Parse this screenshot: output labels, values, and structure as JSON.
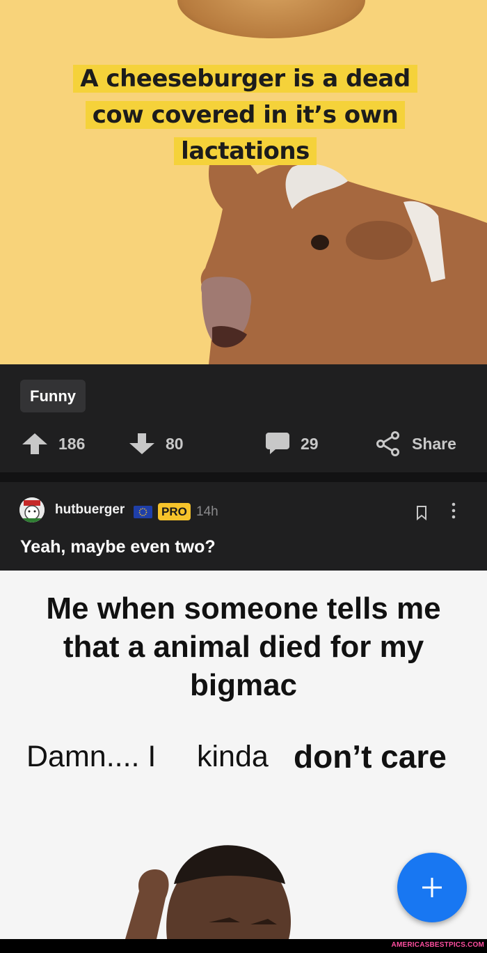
{
  "post": {
    "image_caption": "A cheeseburger is a dead cow covered in it’s own lactations",
    "tag": "Funny",
    "upvotes": "186",
    "downvotes": "80",
    "comments": "29",
    "share_label": "Share"
  },
  "comment": {
    "username": "hutbuerger",
    "badge": "PRO",
    "time": "14h",
    "text": "Yeah, maybe even two?",
    "image": {
      "title": "Me when someone tells me that a animal died for my bigmac",
      "word1": "Damn.... I",
      "word2": "kinda",
      "word3": "don’t care"
    }
  },
  "fab": {
    "icon": "plus-icon"
  },
  "watermark": "AMERICASBESTPICS.COM",
  "colors": {
    "accent": "#1877f2",
    "pro": "#f6c32b",
    "meme_bg": "#f8d37a"
  }
}
